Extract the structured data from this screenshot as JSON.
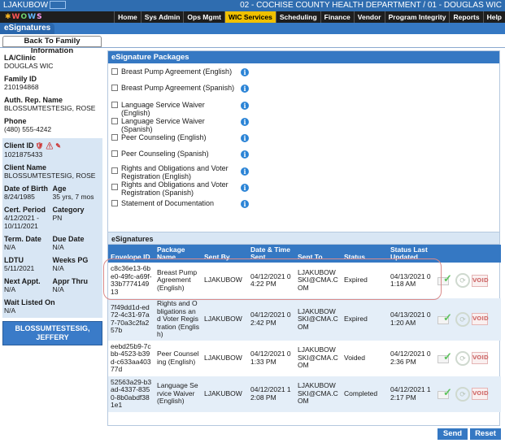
{
  "header": {
    "username": "LJAKUBOW",
    "location": "02 - COCHISE COUNTY HEALTH DEPARTMENT / 01 - DOUGLAS WIC"
  },
  "logo": {
    "text": "WOWS"
  },
  "nav": {
    "items": [
      {
        "label": "Home",
        "active": false
      },
      {
        "label": "Sys Admin",
        "active": false
      },
      {
        "label": "Ops Mgmt",
        "active": false
      },
      {
        "label": "WIC Services",
        "active": true
      },
      {
        "label": "Scheduling",
        "active": false
      },
      {
        "label": "Finance",
        "active": false
      },
      {
        "label": "Vendor",
        "active": false
      },
      {
        "label": "Program Integrity",
        "active": false
      },
      {
        "label": "Reports",
        "active": false
      },
      {
        "label": "Help",
        "active": false
      }
    ]
  },
  "page": {
    "title": "eSignatures",
    "back_label": "Back To Family Information"
  },
  "family": {
    "la_clinic_label": "LA/Clinic",
    "la_clinic": "DOUGLAS WIC",
    "family_id_label": "Family ID",
    "family_id": "210194868",
    "auth_rep_label": "Auth. Rep. Name",
    "auth_rep": "BLOSSUMTESTESIG, ROSE",
    "phone_label": "Phone",
    "phone": "(480) 555-4242"
  },
  "client": {
    "id_label": "Client ID",
    "id": "1021875433",
    "name_label": "Client Name",
    "name": "BLOSSUMTESTESIG, ROSE",
    "dob_label": "Date of Birth",
    "dob": "8/24/1985",
    "age_label": "Age",
    "age": "35 yrs, 7 mos",
    "cert_label": "Cert. Period",
    "cert": "4/12/2021 - 10/11/2021",
    "category_label": "Category",
    "category": "PN",
    "term_label": "Term. Date",
    "term": "N/A",
    "due_label": "Due Date",
    "due": "N/A",
    "ldtu_label": "LDTU",
    "ldtu": "5/11/2021",
    "weeks_label": "Weeks PG",
    "weeks": "N/A",
    "next_appt_label": "Next Appt.",
    "next_appt": "N/A",
    "appr_label": "Appr Thru",
    "appr": "N/A",
    "wait_label": "Wait Listed On",
    "wait": "N/A",
    "member_button": "BLOSSUMTESTESIG, JEFFERY"
  },
  "packages": {
    "title": "eSignature Packages",
    "items": [
      {
        "label": "Breast Pump Agreement (English)"
      },
      {
        "label": "Breast Pump Agreement (Spanish)"
      },
      {
        "label": "Language Service Waiver (English)"
      },
      {
        "label": "Language Service Waiver (Spanish)"
      },
      {
        "label": "Peer Counseling (English)"
      },
      {
        "label": "Peer Counseling (Spanish)"
      },
      {
        "label": "Rights and Obligations and Voter Registration (English)"
      },
      {
        "label": "Rights and Obligations and Voter Registration (Spanish)"
      },
      {
        "label": "Statement of Documentation"
      }
    ]
  },
  "esignatures": {
    "title": "eSignatures",
    "columns": [
      "Envelope ID",
      "Package Name",
      "Sent By",
      "Date & Time Sent",
      "Sent To",
      "Status",
      "Status Last Updated",
      ""
    ],
    "rows": [
      {
        "envelope": "c8c36e13-6be0-49fc-a69f-33b777414913",
        "package": "Breast Pump Agreement (English)",
        "sent_by": "LJAKUBOW",
        "sent": "04/12/2021 04:22 PM",
        "sent_to": "LJAKUBOWSKI@CMA.COM",
        "status": "Expired",
        "updated": "04/13/2021 01:18 AM"
      },
      {
        "envelope": "7f49dd1d-ed72-4c31-97a7-70a3c2fa257b",
        "package": "Rights and Obligations and Voter Registration (English)",
        "sent_by": "LJAKUBOW",
        "sent": "04/12/2021 02:42 PM",
        "sent_to": "LJAKUBOWSKI@CMA.COM",
        "status": "Expired",
        "updated": "04/13/2021 01:20 AM"
      },
      {
        "envelope": "eebd25b9-7cbb-4523-b39d-c633aa40377d",
        "package": "Peer Counseling (English)",
        "sent_by": "LJAKUBOW",
        "sent": "04/12/2021 01:33 PM",
        "sent_to": "LJAKUBOWSKI@CMA.COM",
        "status": "Voided",
        "updated": "04/12/2021 02:36 PM"
      },
      {
        "envelope": "52563a29-b3ad-4337-8350-8b0abdf381e1",
        "package": "Language Service Waiver (English)",
        "sent_by": "LJAKUBOW",
        "sent": "04/12/2021 12:08 PM",
        "sent_to": "LJAKUBOWSKI@CMA.COM",
        "status": "Completed",
        "updated": "04/12/2021 12:17 PM"
      }
    ],
    "void_label": "VOID"
  },
  "buttons": {
    "send": "Send",
    "reset": "Reset"
  }
}
